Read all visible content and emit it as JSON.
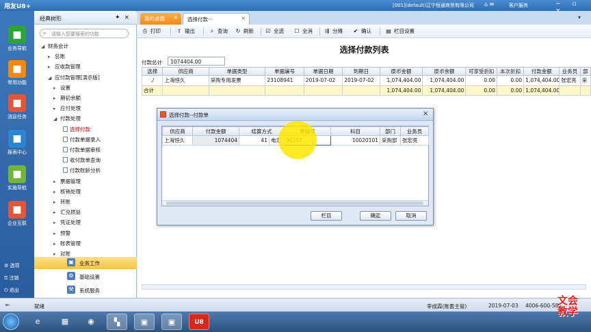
{
  "titlebar": {
    "brand": "用友U8+",
    "company": "[001](default)辽宁恒通商贸有限公司",
    "service": "客户服务",
    "window_controls": "− ▫ ×"
  },
  "leftnav": {
    "items": [
      {
        "label": "业务导航",
        "icon": "business-nav-icon",
        "color": "#2ea33a"
      },
      {
        "label": "常用功能",
        "icon": "star-icon",
        "color": "#f08a12"
      },
      {
        "label": "消息任务",
        "icon": "message-icon",
        "color": "#e4563a"
      },
      {
        "label": "报表中心",
        "icon": "report-icon",
        "color": "#2a86d0"
      },
      {
        "label": "实施导航",
        "icon": "compass-icon",
        "color": "#6fb63a"
      },
      {
        "label": "企业互联",
        "icon": "link-icon",
        "color": "#e4563a"
      }
    ],
    "bottom": [
      "选项",
      "注销",
      "退出"
    ]
  },
  "tree": {
    "header": "经典树形",
    "search_placeholder": "请输入您要搜索的功能",
    "nodes": [
      {
        "label": "财务会计",
        "arrow": "◢",
        "level": 0
      },
      {
        "label": "总账",
        "arrow": "▸",
        "level": 1
      },
      {
        "label": "应收款管理",
        "arrow": "▸",
        "level": 1
      },
      {
        "label": "应付款管理[演示版]",
        "arrow": "◢",
        "level": 1
      },
      {
        "label": "设置",
        "arrow": "▸",
        "level": 2
      },
      {
        "label": "期初余额",
        "arrow": "▸",
        "level": 2
      },
      {
        "label": "应付处理",
        "arrow": "▸",
        "level": 2
      },
      {
        "label": "付款处理",
        "arrow": "◢",
        "level": 2
      },
      {
        "label": "选择付款",
        "arrow": "",
        "level": 3,
        "selected": true
      },
      {
        "label": "付款单据录入",
        "arrow": "",
        "level": 3
      },
      {
        "label": "付款单据审核",
        "arrow": "",
        "level": 3
      },
      {
        "label": "收付款单查询",
        "arrow": "",
        "level": 3
      },
      {
        "label": "付款账龄分析",
        "arrow": "",
        "level": 3
      },
      {
        "label": "票据管理",
        "arrow": "▸",
        "level": 2
      },
      {
        "label": "核销处理",
        "arrow": "▸",
        "level": 2
      },
      {
        "label": "转账",
        "arrow": "▸",
        "level": 2
      },
      {
        "label": "汇兑损益",
        "arrow": "▸",
        "level": 2
      },
      {
        "label": "凭证处理",
        "arrow": "▸",
        "level": 2
      },
      {
        "label": "预警",
        "arrow": "▸",
        "level": 2
      },
      {
        "label": "账表管理",
        "arrow": "▸",
        "level": 2
      },
      {
        "label": "对账",
        "arrow": "▸",
        "level": 2
      }
    ],
    "bottom_items": [
      "业务工作",
      "基础设置",
      "系统服务"
    ]
  },
  "tabs": {
    "home": "我的桌面",
    "active": "选择付款···"
  },
  "toolbar": {
    "buttons": [
      {
        "label": "打印",
        "icon": "print-icon",
        "glyph": "⎙"
      },
      {
        "label": "输出",
        "icon": "export-icon",
        "glyph": "⇪"
      },
      {
        "label": "查询",
        "icon": "query-icon",
        "glyph": "⌕"
      },
      {
        "label": "刷新",
        "icon": "refresh-icon",
        "glyph": "↻"
      },
      {
        "label": "全选",
        "icon": "select-all-icon",
        "glyph": "☑"
      },
      {
        "label": "全消",
        "icon": "deselect-all-icon",
        "glyph": "☐"
      },
      {
        "label": "分摊",
        "icon": "allocate-icon",
        "glyph": "⇶"
      },
      {
        "label": "确认",
        "icon": "confirm-icon",
        "glyph": "✔"
      },
      {
        "label": "栏目设置",
        "icon": "columns-icon",
        "glyph": "▤"
      }
    ]
  },
  "page": {
    "title": "选择付款列表",
    "total_label": "付款总计",
    "total_value": "1074404.00"
  },
  "grid": {
    "columns": [
      "选择",
      "供应商",
      "单据类型",
      "单据编号",
      "单据日期",
      "到期日",
      "原币金额",
      "原币余额",
      "可享受折扣",
      "本次折扣",
      "付款金额",
      "业务员",
      "部"
    ],
    "rows": [
      [
        "./",
        "上海恒久",
        "采购专用发票",
        "23108941",
        "2019-07-02",
        "2019-07-02",
        "1,074,404.00",
        "1,074,404.00",
        "0.00",
        "0.00",
        "1,074,404.00",
        "张宏亮",
        "采"
      ]
    ],
    "sum_row": [
      "合计",
      "",
      "",
      "",
      "",
      "",
      "1,074,404.00",
      "1,074,404.00",
      "0.00",
      "0.00",
      "1,074,404.00",
      "",
      ""
    ]
  },
  "dialog": {
    "title": "选择付款--付款单",
    "columns": [
      "供应商",
      "付款金额",
      "结算方式",
      "票据号",
      "科目",
      "部门",
      "业务员"
    ],
    "row": {
      "supplier": "上海恒久",
      "amount": "1074404",
      "settle_code": "41",
      "settle_name": "电汇",
      "ticket_no": "3625T",
      "account": "10020101",
      "dept": "采购部",
      "clerk": "张宏亮"
    },
    "buttons": {
      "columns": "栏目",
      "ok": "确定",
      "cancel": "取消"
    }
  },
  "statusbar": {
    "ready": "就绪",
    "user": "李成霖(账套主管)",
    "date": "2019-07-03",
    "phone": "4006-600-588"
  },
  "taskbar": {
    "icons": [
      "ie-icon",
      "explorer-icon",
      "chrome-icon",
      "app-icon",
      "terminal-icon",
      "terminal2-icon",
      "u8-icon"
    ]
  },
  "watermark": "文会\n教学"
}
